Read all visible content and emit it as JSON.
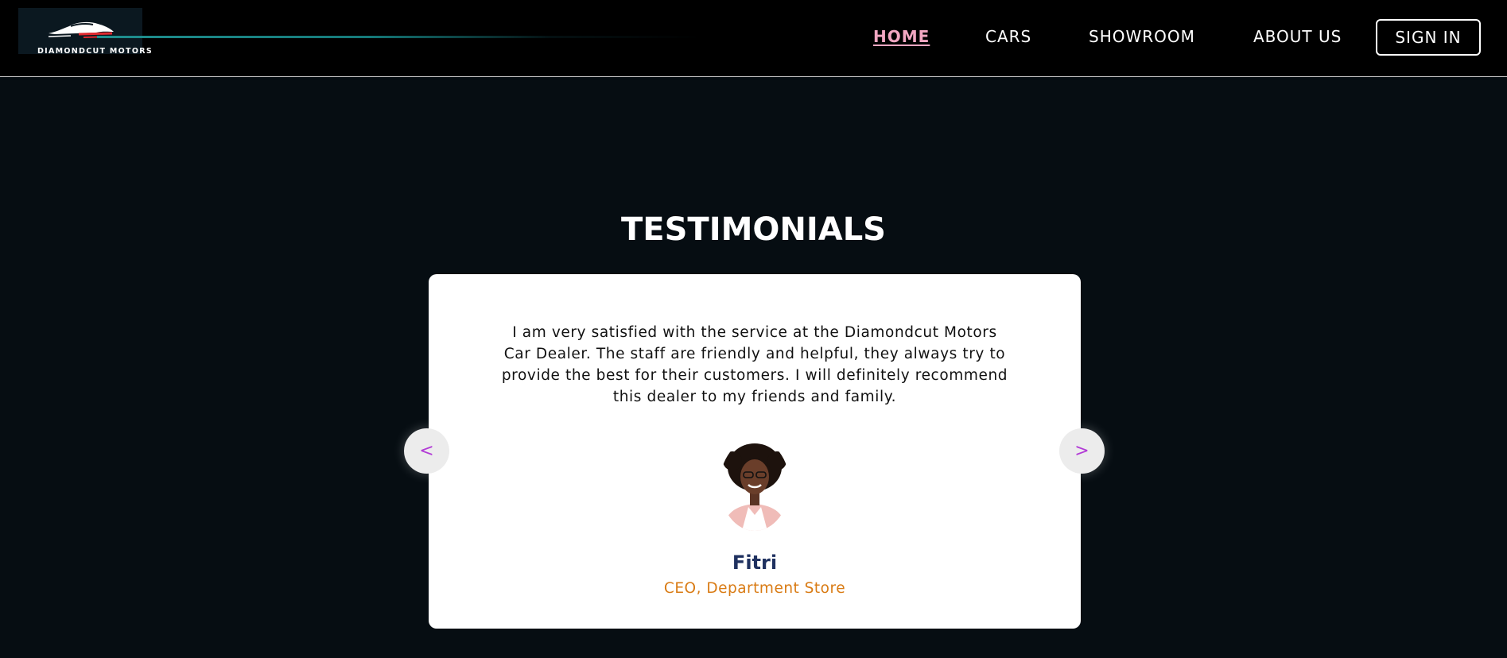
{
  "brand": {
    "logo_text": "DIAMONDCUT MOTORS",
    "accent_color": "#1f8f8f"
  },
  "nav": {
    "items": [
      {
        "label": "HOME",
        "active": true
      },
      {
        "label": "CARS",
        "active": false
      },
      {
        "label": "SHOWROOM",
        "active": false
      },
      {
        "label": "ABOUT US",
        "active": false
      }
    ],
    "signin_label": "SIGN IN",
    "active_color": "#f2a7c2"
  },
  "testimonials": {
    "title": "TESTIMONIALS",
    "prev_label": "<",
    "next_label": ">",
    "current": {
      "quote": "I am very satisfied with the service at the Diamondcut Motors Car Dealer. The staff are friendly and helpful, they always try to provide the best for their customers. I will definitely recommend this dealer to my friends and family.",
      "name": "Fitri",
      "role": "CEO, Department Store",
      "avatar_icon": "person-avatar"
    },
    "name_color": "#1f3160",
    "role_color": "#d97b14",
    "arrow_color": "#b23bd6"
  }
}
